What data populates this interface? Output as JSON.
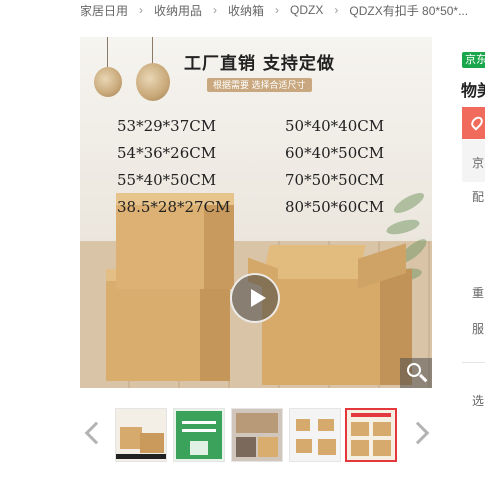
{
  "breadcrumb": {
    "items": [
      "家居日用",
      "收纳用品",
      "收纳箱",
      "QDZX",
      "QDZX有扣手 80*50*..."
    ],
    "separator": "›"
  },
  "gallery": {
    "banner_title": "工厂直销 支持定做",
    "banner_subtitle": "根据需要 选择合适尺寸",
    "sizes_left": [
      "53*29*37CM",
      "54*36*26CM",
      "55*40*50CM",
      "38.5*28*27CM"
    ],
    "sizes_right": [
      "50*40*40CM",
      "60*40*50CM",
      "70*50*50CM",
      "80*50*60CM"
    ],
    "thumbnail_count": 5,
    "active_thumbnail": 5
  },
  "side": {
    "store_tag": "京东",
    "title": "物美",
    "label_delivery_area": "京",
    "label_delivery": "配",
    "label_weight": "重",
    "label_service": "服",
    "label_select": "选"
  },
  "colors": {
    "accent_red": "#e4393c",
    "jd_green": "#1aa64a",
    "price_bg": "#f06b5b",
    "cardboard": "#d6aa6c"
  }
}
